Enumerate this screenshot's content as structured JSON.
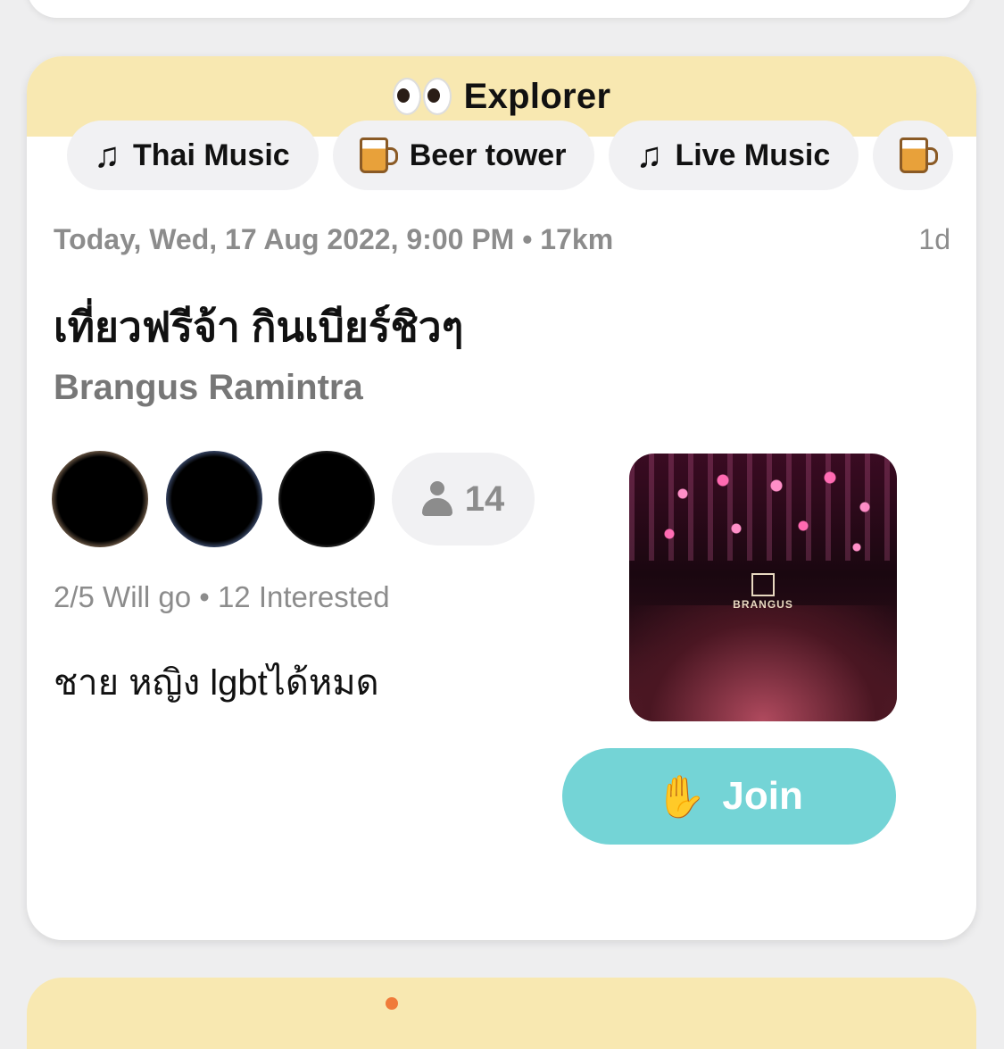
{
  "explorer": {
    "title": "Explorer",
    "chips": [
      {
        "icon": "music-note-icon",
        "label": "Thai Music"
      },
      {
        "icon": "beer-mug-icon",
        "label": "Beer tower"
      },
      {
        "icon": "music-note-icon",
        "label": "Live Music"
      }
    ]
  },
  "event": {
    "datetime": "Today, Wed, 17 Aug 2022, 9:00 PM • 17km",
    "ago": "1d",
    "title": "เที่ยวฟรีจ้า กินเบียร์ชิวๆ",
    "venue": "Brangus Ramintra",
    "attendee_count": "14",
    "attendance": "2/5 Will go • 12 Interested",
    "description": "ชาย หญิง lgbtได้หมด",
    "photo_sign": "BRANGUS"
  },
  "actions": {
    "join_label": "Join"
  },
  "colors": {
    "header_bg": "#f8e8b1",
    "join_bg": "#74d4d6",
    "chip_bg": "#f1f1f3"
  }
}
